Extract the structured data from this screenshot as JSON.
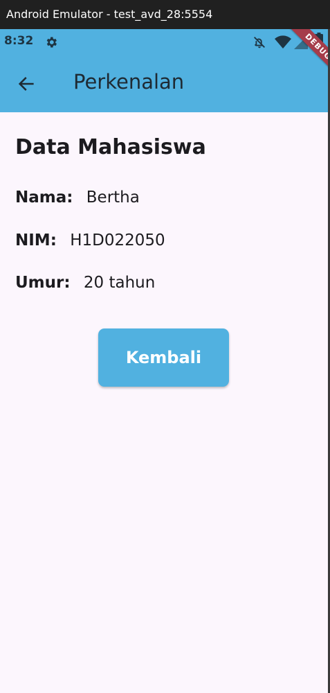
{
  "window": {
    "title": "Android Emulator - test_avd_28:5554"
  },
  "status_bar": {
    "time": "8:32",
    "icons": [
      "gear-icon",
      "bell-off-icon",
      "wifi-icon",
      "signal-icon",
      "battery-icon"
    ],
    "color": "#51b1e0"
  },
  "debug_banner": {
    "label": "DEBUG",
    "color": "#a53c4a"
  },
  "app_bar": {
    "back_icon": "arrow-left-icon",
    "title": "Perkenalan",
    "color": "#51b1e0"
  },
  "profile": {
    "heading": "Data Mahasiswa",
    "name_label": "Nama:",
    "name_value": "Bertha",
    "nim_label": "NIM:",
    "nim_value": "H1D022050",
    "age_label": "Umur:",
    "age_value": "20 tahun"
  },
  "actions": {
    "back_label": "Kembali",
    "button_color": "#51b1e0"
  },
  "theme": {
    "background": "#fcf6fd",
    "text": "#1c1b1f"
  }
}
